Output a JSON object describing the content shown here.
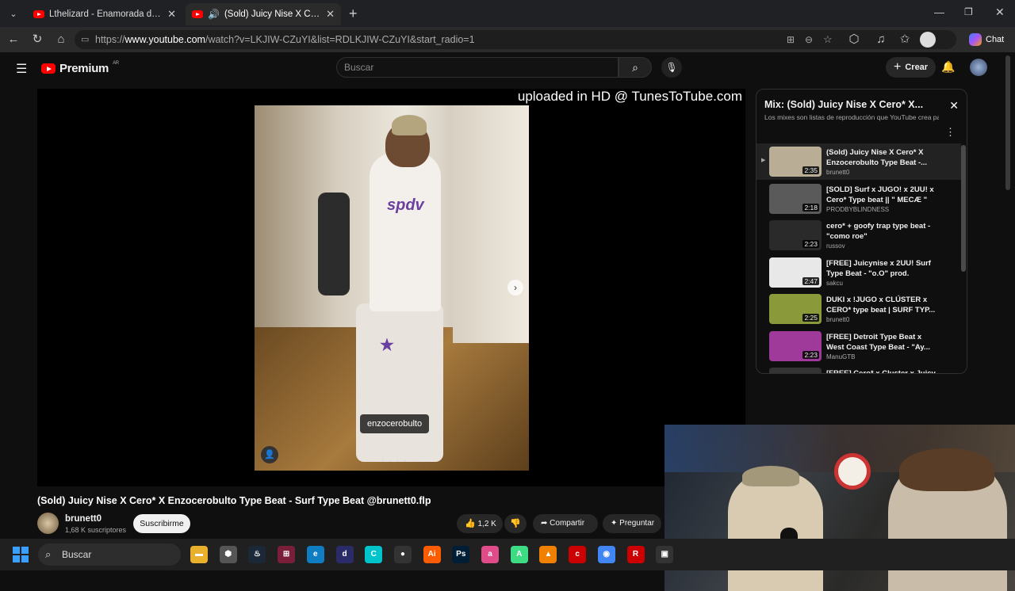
{
  "browser": {
    "tabs": [
      {
        "title": "Lthelizard - Enamorada del L (Vide"
      },
      {
        "title": "(Sold) Juicy Nise X Cero* X En"
      }
    ],
    "url_prefix": "https://",
    "url_host": "www.youtube.com",
    "url_path": "/watch?v=LKJIW-CZuYI&list=RDLKJIW-CZuYI&start_radio=1",
    "chat_label": "Chat"
  },
  "youtube": {
    "logo_text": "Premium",
    "logo_sup": "AR",
    "search_placeholder": "Buscar",
    "create_label": "Crear",
    "player_overlay": "uploaded in HD @ TunesToTube.com",
    "image_tag": "enzocerobulto",
    "shirt_text": "spdv",
    "video_title": "(Sold) Juicy Nise X Cero* X Enzocerobulto Type Beat - Surf Type Beat @brunett0.flp",
    "channel_name": "brunett0",
    "channel_subs": "1,68 K suscriptores",
    "subscribe_label": "Suscribirme",
    "likes": "1,2 K",
    "share_label": "Compartir",
    "ask_label": "Preguntar"
  },
  "playlist": {
    "title": "Mix: (Sold) Juicy Nise X Cero* X...",
    "subtitle": "Los mixes son listas de reproducción que YouTube crea par...",
    "items": [
      {
        "title": "(Sold) Juicy Nise X Cero* X Enzocerobulto Type Beat -...",
        "channel": "brunett0",
        "duration": "2:35",
        "thumb": "#b9ad96"
      },
      {
        "title": "[SOLD] Surf x JUGO! x 2UU! x Cero* Type beat || \" MECÆ \" ||...",
        "channel": "PRODBYBLINDNESS",
        "duration": "2:18",
        "thumb": "#5a5a5a"
      },
      {
        "title": "cero* + goofy trap type beat - \"como roe\"",
        "channel": "russov",
        "duration": "2:23",
        "thumb": "#2a2a2a"
      },
      {
        "title": "[FREE] Juicynise x 2UU! Surf Type Beat - \"o.O\" prod. sakcu...",
        "channel": "sakcu",
        "duration": "2:47",
        "thumb": "#e8e8e8"
      },
      {
        "title": "DUKI x !JUGO x CLÚSTER x CERO* type beat | SURF TYP...",
        "channel": "brunett0",
        "duration": "2:25",
        "thumb": "#8a9a3a"
      },
      {
        "title": "[FREE] Detroit Type Beat x West Coast Type Beat - \"Ay...",
        "channel": "ManuGTB",
        "duration": "2:23",
        "thumb": "#a03a9a"
      },
      {
        "title": "[FREE] Cero* x Cluster x Juicy",
        "channel": "",
        "duration": "",
        "thumb": "#333333"
      }
    ]
  },
  "taskbar": {
    "search_placeholder": "Buscar",
    "apps": [
      "explorer",
      "settings",
      "steam",
      "davinci",
      "edge",
      "discord",
      "canva",
      "obs",
      "illustrator",
      "photoshop",
      "affinity",
      "android",
      "vlc",
      "capcut",
      "chrome",
      "rockstar",
      "other"
    ]
  }
}
